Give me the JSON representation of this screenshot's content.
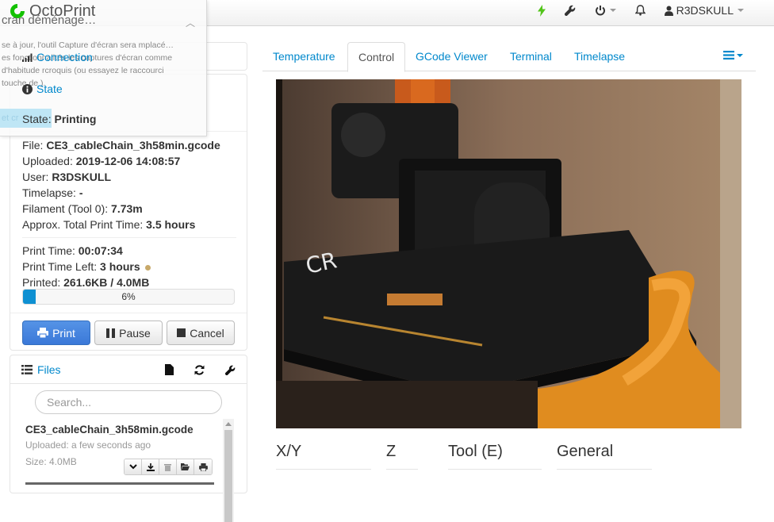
{
  "navbar": {
    "brand": "OctoPrint",
    "user": "R3DSKULL",
    "icons": [
      "bolt-icon",
      "wrench-icon",
      "power-icon",
      "bell-icon",
      "user-icon"
    ]
  },
  "overlay": {
    "title": "cran déménage…",
    "body": "se à jour, l'outil Capture d'écran sera mplacé… es fonctionnalités les captures d'écran comme d'habitude rcroquis (ou essayez le raccourci touche de ).",
    "button": "et cr"
  },
  "connection": {
    "label": "Connection"
  },
  "state": {
    "header": "State",
    "status_label": "State:",
    "status_value": "Printing",
    "file_label": "File:",
    "file_value": "CE3_cableChain_3h58min.gcode",
    "uploaded_label": "Uploaded:",
    "uploaded_value": "2019-12-06 14:08:57",
    "user_label": "User:",
    "user_value": "R3DSKULL",
    "timelapse_label": "Timelapse:",
    "timelapse_value": "-",
    "filament_label": "Filament (Tool 0):",
    "filament_value": "7.73m",
    "approx_label": "Approx. Total Print Time:",
    "approx_value": "3.5 hours",
    "print_time_label": "Print Time:",
    "print_time_value": "00:07:34",
    "time_left_label": "Print Time Left:",
    "time_left_value": "3 hours",
    "printed_label": "Printed:",
    "printed_value": "261.6KB / 4.0MB",
    "progress_percent": 6,
    "progress_text": "6%"
  },
  "buttons": {
    "print": "Print",
    "pause": "Pause",
    "cancel": "Cancel"
  },
  "files": {
    "header": "Files",
    "search_placeholder": "Search...",
    "items": [
      {
        "name": "CE3_cableChain_3h58min.gcode",
        "uploaded": "Uploaded: a few seconds ago",
        "size": "Size: 4.0MB"
      }
    ]
  },
  "tabs": [
    {
      "label": "Temperature",
      "active": false
    },
    {
      "label": "Control",
      "active": true
    },
    {
      "label": "GCode Viewer",
      "active": false
    },
    {
      "label": "Terminal",
      "active": false
    },
    {
      "label": "Timelapse",
      "active": false
    }
  ],
  "control": {
    "xy": "X/Y",
    "z": "Z",
    "tool": "Tool (E)",
    "general": "General"
  },
  "colors": {
    "link": "#0088cc",
    "primary": "#3a78d8",
    "progress": "#0e90d2",
    "bolt": "#52c41a"
  }
}
